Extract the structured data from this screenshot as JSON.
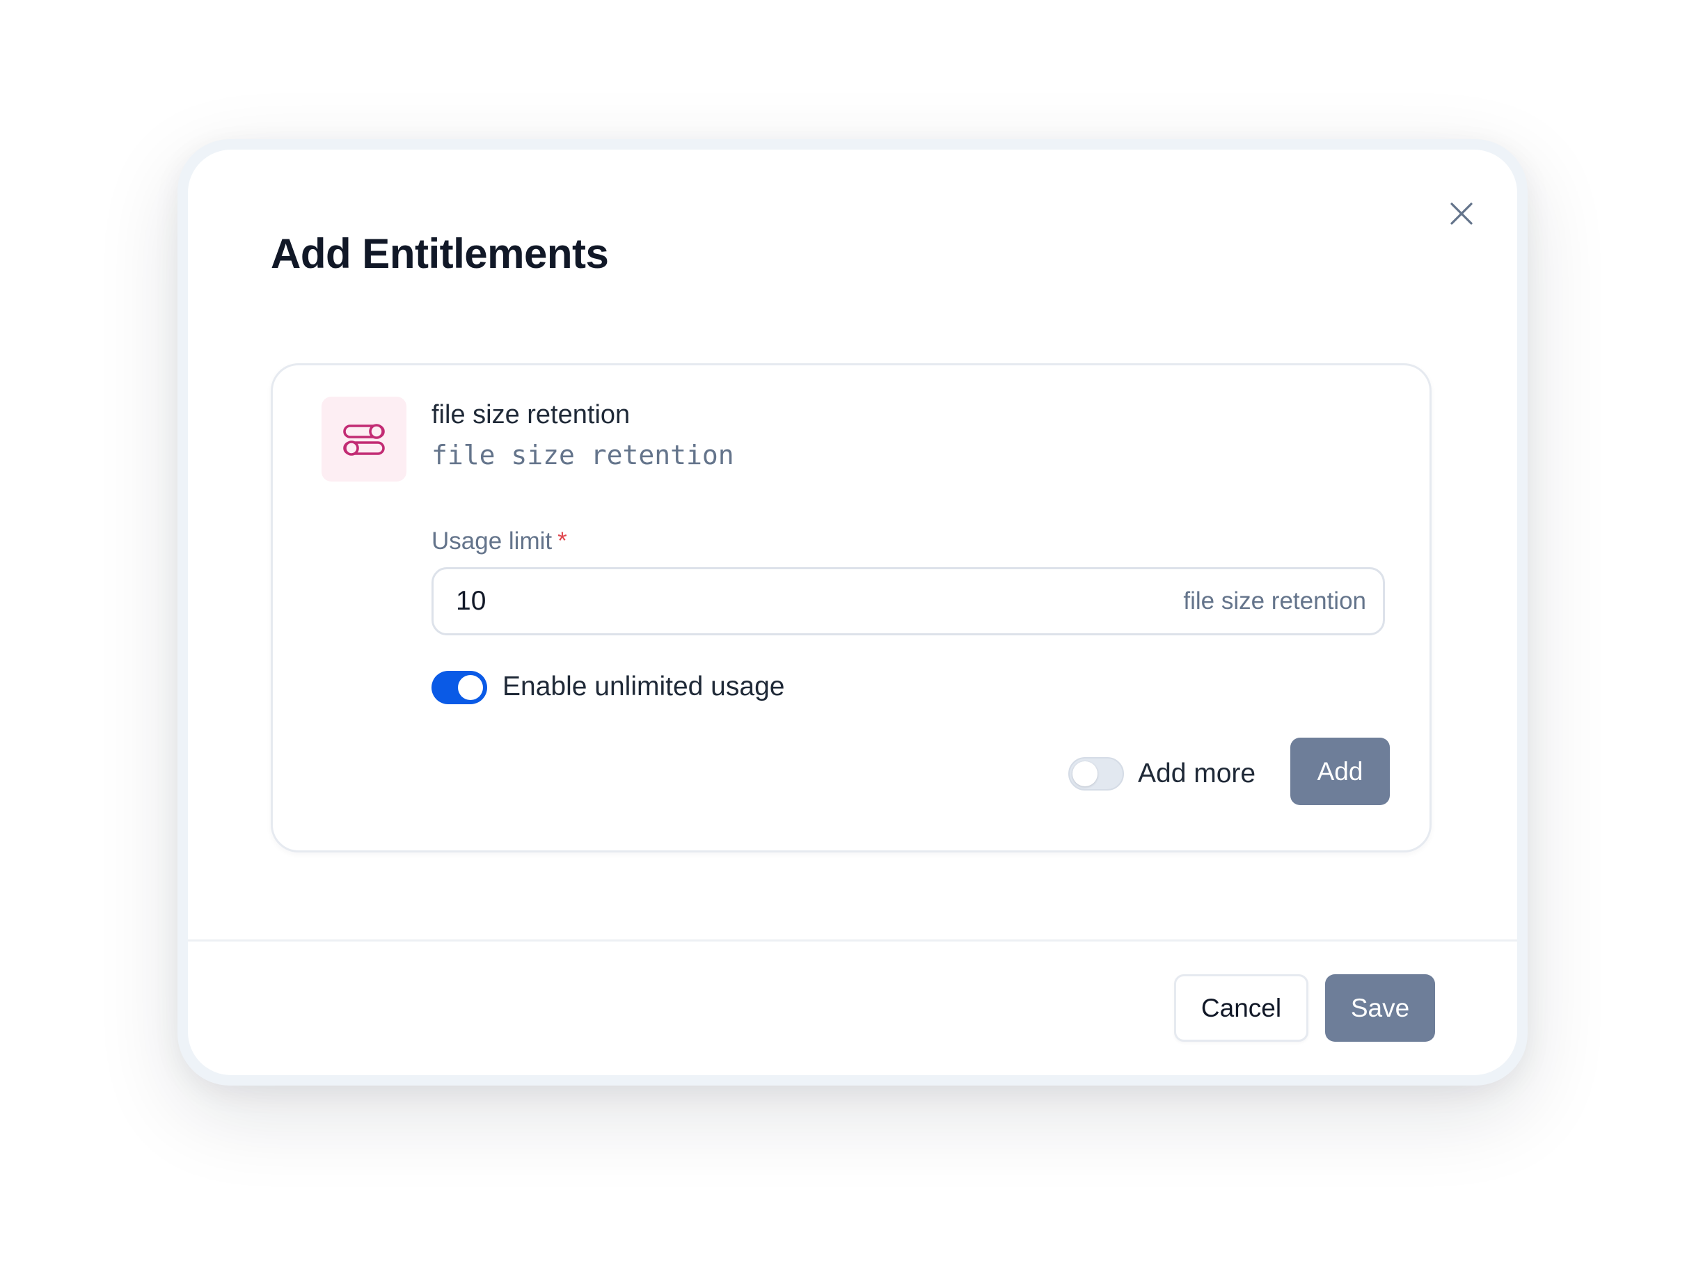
{
  "modal": {
    "title": "Add Entitlements",
    "close_icon": "close-icon"
  },
  "entitlement": {
    "icon": "toggles-icon",
    "icon_color": "#c22b73",
    "name": "file size retention",
    "id": "file size retention",
    "usage_limit": {
      "label": "Usage limit",
      "required_marker": "*",
      "value": "10",
      "unit_suffix": "file size retention"
    },
    "unlimited_toggle": {
      "label": "Enable unlimited usage",
      "checked": true,
      "color": "#0a5ae6"
    },
    "add_more_toggle": {
      "label": "Add more",
      "checked": false
    },
    "add_button_label": "Add"
  },
  "footer": {
    "cancel_label": "Cancel",
    "save_label": "Save"
  }
}
